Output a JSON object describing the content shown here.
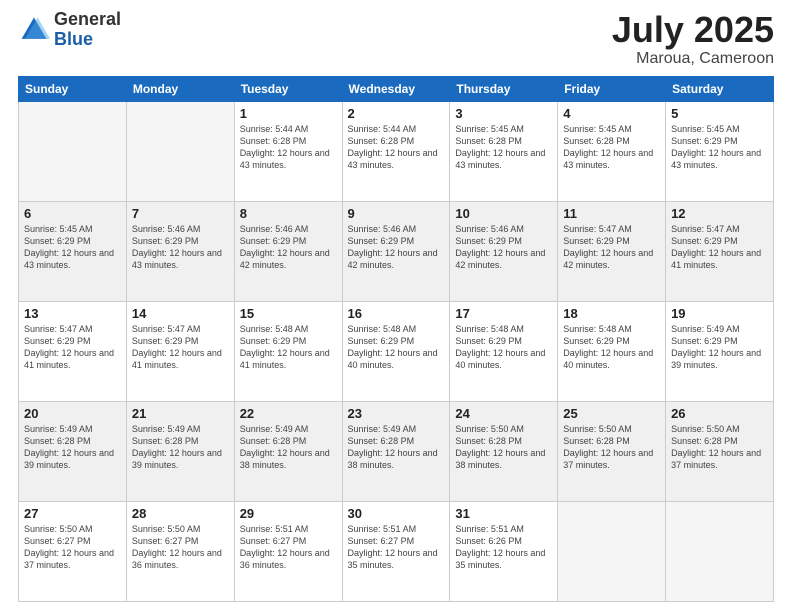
{
  "logo": {
    "general": "General",
    "blue": "Blue"
  },
  "title": {
    "month": "July 2025",
    "location": "Maroua, Cameroon"
  },
  "header_days": [
    "Sunday",
    "Monday",
    "Tuesday",
    "Wednesday",
    "Thursday",
    "Friday",
    "Saturday"
  ],
  "weeks": [
    {
      "shaded": false,
      "days": [
        {
          "num": "",
          "info": ""
        },
        {
          "num": "",
          "info": ""
        },
        {
          "num": "1",
          "info": "Sunrise: 5:44 AM\nSunset: 6:28 PM\nDaylight: 12 hours and 43 minutes."
        },
        {
          "num": "2",
          "info": "Sunrise: 5:44 AM\nSunset: 6:28 PM\nDaylight: 12 hours and 43 minutes."
        },
        {
          "num": "3",
          "info": "Sunrise: 5:45 AM\nSunset: 6:28 PM\nDaylight: 12 hours and 43 minutes."
        },
        {
          "num": "4",
          "info": "Sunrise: 5:45 AM\nSunset: 6:28 PM\nDaylight: 12 hours and 43 minutes."
        },
        {
          "num": "5",
          "info": "Sunrise: 5:45 AM\nSunset: 6:29 PM\nDaylight: 12 hours and 43 minutes."
        }
      ]
    },
    {
      "shaded": true,
      "days": [
        {
          "num": "6",
          "info": "Sunrise: 5:45 AM\nSunset: 6:29 PM\nDaylight: 12 hours and 43 minutes."
        },
        {
          "num": "7",
          "info": "Sunrise: 5:46 AM\nSunset: 6:29 PM\nDaylight: 12 hours and 43 minutes."
        },
        {
          "num": "8",
          "info": "Sunrise: 5:46 AM\nSunset: 6:29 PM\nDaylight: 12 hours and 42 minutes."
        },
        {
          "num": "9",
          "info": "Sunrise: 5:46 AM\nSunset: 6:29 PM\nDaylight: 12 hours and 42 minutes."
        },
        {
          "num": "10",
          "info": "Sunrise: 5:46 AM\nSunset: 6:29 PM\nDaylight: 12 hours and 42 minutes."
        },
        {
          "num": "11",
          "info": "Sunrise: 5:47 AM\nSunset: 6:29 PM\nDaylight: 12 hours and 42 minutes."
        },
        {
          "num": "12",
          "info": "Sunrise: 5:47 AM\nSunset: 6:29 PM\nDaylight: 12 hours and 41 minutes."
        }
      ]
    },
    {
      "shaded": false,
      "days": [
        {
          "num": "13",
          "info": "Sunrise: 5:47 AM\nSunset: 6:29 PM\nDaylight: 12 hours and 41 minutes."
        },
        {
          "num": "14",
          "info": "Sunrise: 5:47 AM\nSunset: 6:29 PM\nDaylight: 12 hours and 41 minutes."
        },
        {
          "num": "15",
          "info": "Sunrise: 5:48 AM\nSunset: 6:29 PM\nDaylight: 12 hours and 41 minutes."
        },
        {
          "num": "16",
          "info": "Sunrise: 5:48 AM\nSunset: 6:29 PM\nDaylight: 12 hours and 40 minutes."
        },
        {
          "num": "17",
          "info": "Sunrise: 5:48 AM\nSunset: 6:29 PM\nDaylight: 12 hours and 40 minutes."
        },
        {
          "num": "18",
          "info": "Sunrise: 5:48 AM\nSunset: 6:29 PM\nDaylight: 12 hours and 40 minutes."
        },
        {
          "num": "19",
          "info": "Sunrise: 5:49 AM\nSunset: 6:29 PM\nDaylight: 12 hours and 39 minutes."
        }
      ]
    },
    {
      "shaded": true,
      "days": [
        {
          "num": "20",
          "info": "Sunrise: 5:49 AM\nSunset: 6:28 PM\nDaylight: 12 hours and 39 minutes."
        },
        {
          "num": "21",
          "info": "Sunrise: 5:49 AM\nSunset: 6:28 PM\nDaylight: 12 hours and 39 minutes."
        },
        {
          "num": "22",
          "info": "Sunrise: 5:49 AM\nSunset: 6:28 PM\nDaylight: 12 hours and 38 minutes."
        },
        {
          "num": "23",
          "info": "Sunrise: 5:49 AM\nSunset: 6:28 PM\nDaylight: 12 hours and 38 minutes."
        },
        {
          "num": "24",
          "info": "Sunrise: 5:50 AM\nSunset: 6:28 PM\nDaylight: 12 hours and 38 minutes."
        },
        {
          "num": "25",
          "info": "Sunrise: 5:50 AM\nSunset: 6:28 PM\nDaylight: 12 hours and 37 minutes."
        },
        {
          "num": "26",
          "info": "Sunrise: 5:50 AM\nSunset: 6:28 PM\nDaylight: 12 hours and 37 minutes."
        }
      ]
    },
    {
      "shaded": false,
      "days": [
        {
          "num": "27",
          "info": "Sunrise: 5:50 AM\nSunset: 6:27 PM\nDaylight: 12 hours and 37 minutes."
        },
        {
          "num": "28",
          "info": "Sunrise: 5:50 AM\nSunset: 6:27 PM\nDaylight: 12 hours and 36 minutes."
        },
        {
          "num": "29",
          "info": "Sunrise: 5:51 AM\nSunset: 6:27 PM\nDaylight: 12 hours and 36 minutes."
        },
        {
          "num": "30",
          "info": "Sunrise: 5:51 AM\nSunset: 6:27 PM\nDaylight: 12 hours and 35 minutes."
        },
        {
          "num": "31",
          "info": "Sunrise: 5:51 AM\nSunset: 6:26 PM\nDaylight: 12 hours and 35 minutes."
        },
        {
          "num": "",
          "info": ""
        },
        {
          "num": "",
          "info": ""
        }
      ]
    }
  ]
}
